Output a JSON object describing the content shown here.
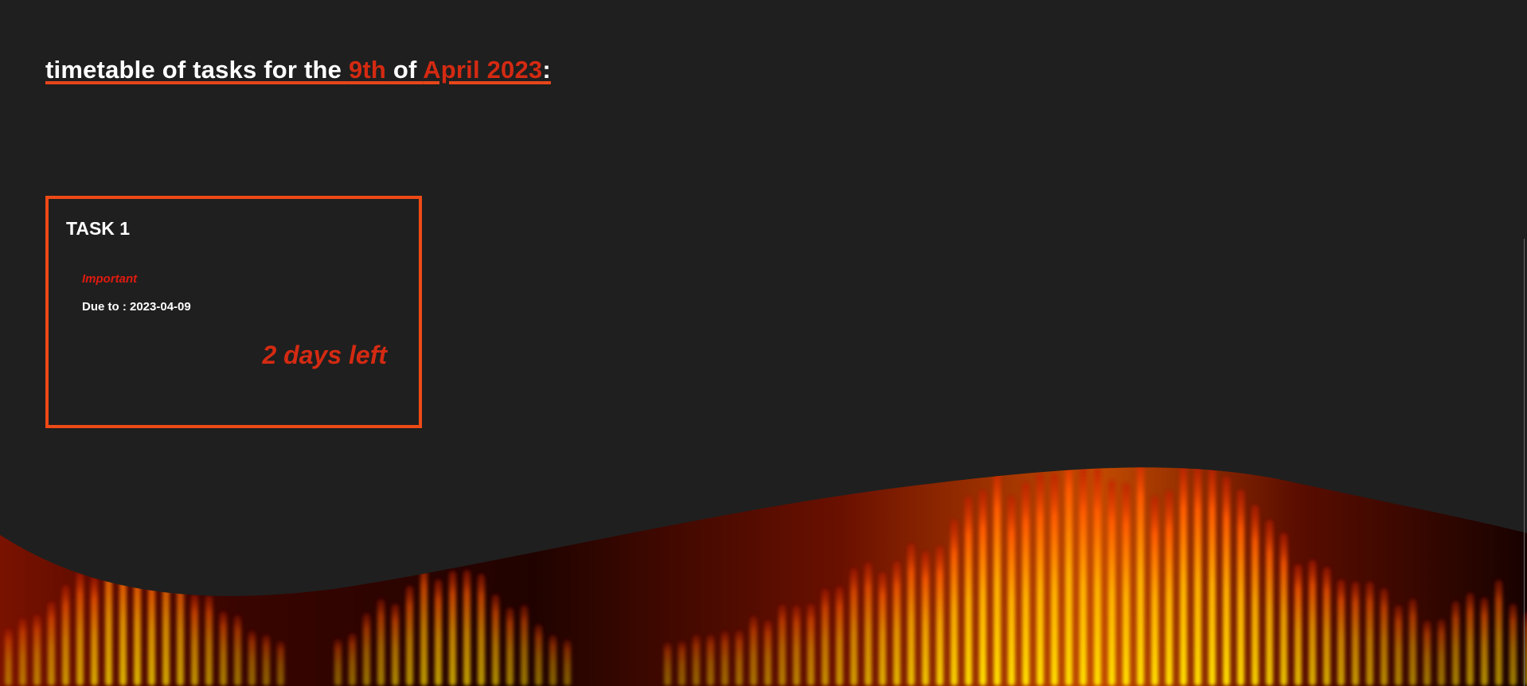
{
  "heading": {
    "prefix": "timetable of tasks for the ",
    "day": "9th",
    "of": " of ",
    "month_year": "April 2023",
    "suffix": ":"
  },
  "task": {
    "title": "TASK 1",
    "priority": "Important",
    "due": "Due to : 2023-04-09",
    "remaining": "2 days left"
  },
  "colors": {
    "background": "#1f1f1f",
    "accent": "#d42a12",
    "card_border": "#ee4a15",
    "priority": "#e01a10",
    "text": "#ffffff"
  }
}
